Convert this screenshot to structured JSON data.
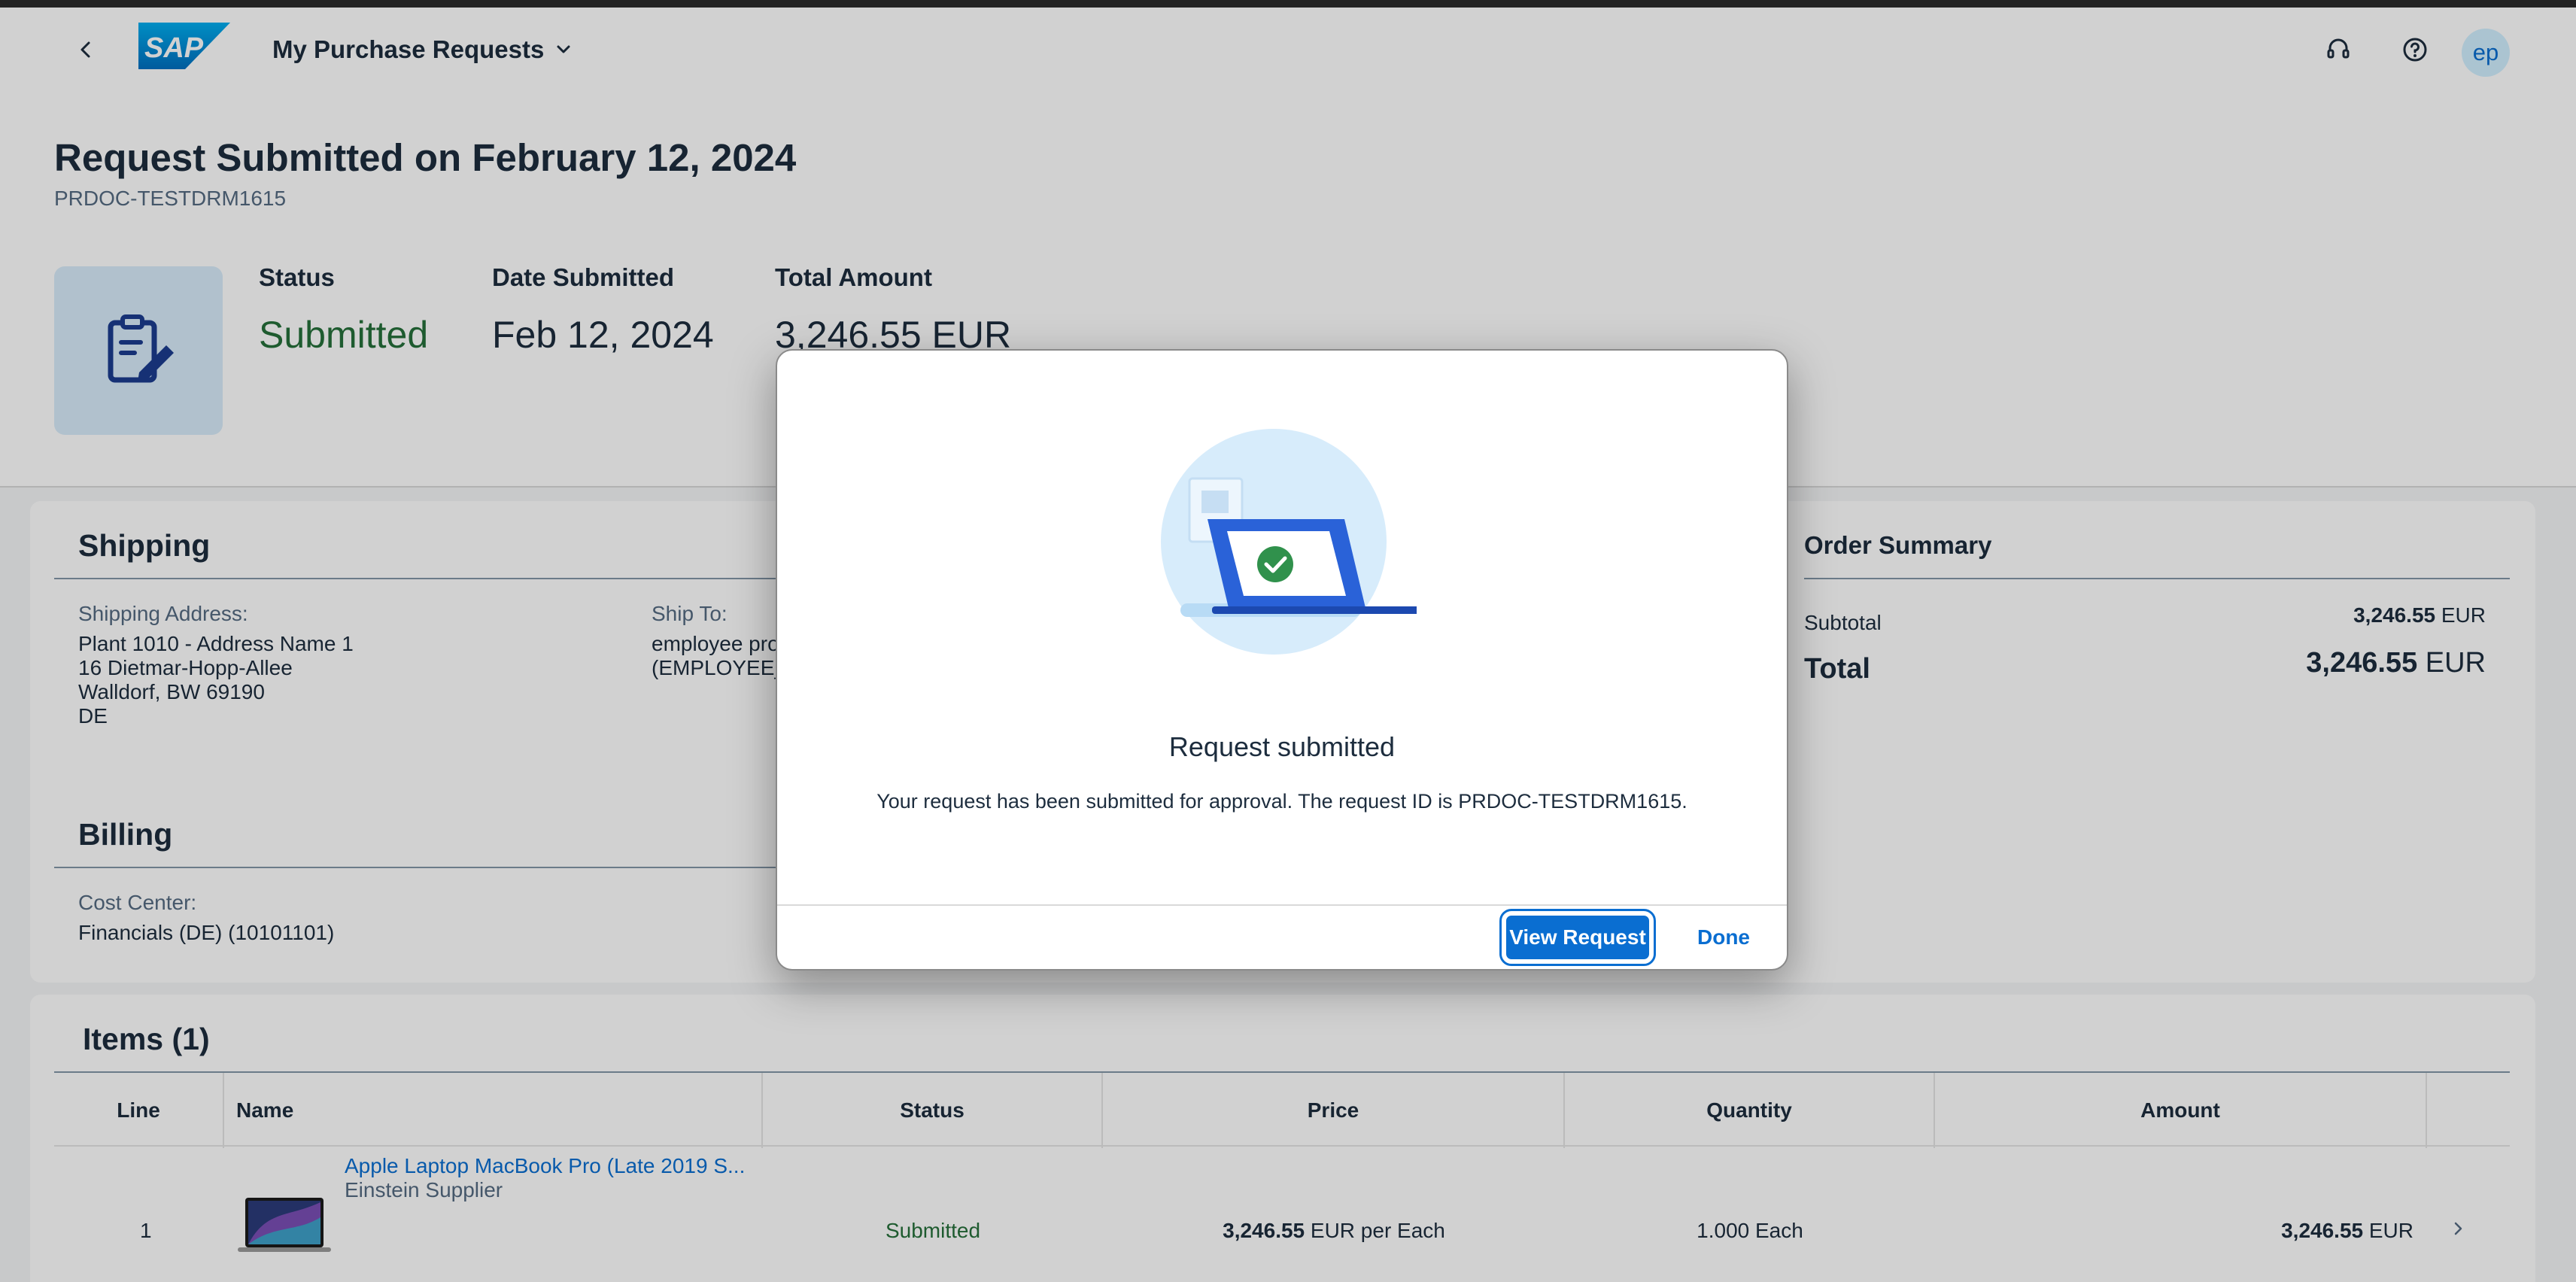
{
  "shell": {
    "app_title": "My Purchase Requests",
    "logo_text": "SAP",
    "avatar_initials": "ep",
    "icons": [
      "back-icon",
      "chevron-down-icon",
      "headset-icon",
      "help-icon"
    ]
  },
  "header": {
    "title": "Request Submitted on February 12, 2024",
    "document_id": "PRDOC-TESTDRM1615",
    "kpis": {
      "status_label": "Status",
      "status_value": "Submitted",
      "date_label": "Date Submitted",
      "date_value": "Feb 12, 2024",
      "amount_label": "Total Amount",
      "amount_value": "3,246.55",
      "amount_currency": "EUR"
    }
  },
  "shipping": {
    "title": "Shipping",
    "address_label": "Shipping Address:",
    "address_lines": [
      "Plant 1010 - Address Name 1",
      "16 Dietmar-Hopp-Allee",
      "Walldorf, BW 69190",
      "DE"
    ],
    "ship_to_label": "Ship To:",
    "ship_to_lines": [
      "employee pro",
      "(EMPLOYEE_"
    ]
  },
  "billing": {
    "title": "Billing",
    "cost_center_label": "Cost Center:",
    "cost_center_value": "Financials (DE) (10101101)"
  },
  "order_summary": {
    "title": "Order Summary",
    "subtotal_label": "Subtotal",
    "subtotal_value": "3,246.55",
    "subtotal_currency": "EUR",
    "total_label": "Total",
    "total_value": "3,246.55",
    "total_currency": "EUR"
  },
  "items": {
    "title": "Items (1)",
    "columns": [
      "Line",
      "Name",
      "Status",
      "Price",
      "Quantity",
      "Amount"
    ],
    "rows": [
      {
        "line": "1",
        "name": "Apple Laptop MacBook Pro (Late 2019 S...",
        "supplier": "Einstein Supplier",
        "status": "Submitted",
        "price_value": "3,246.55",
        "price_unit": "EUR per Each",
        "quantity": "1.000 Each",
        "amount_value": "3,246.55",
        "amount_currency": "EUR"
      }
    ]
  },
  "dialog": {
    "title": "Request submitted",
    "description": "Your request has been submitted for approval. The request ID is PRDOC-TESTDRM1615.",
    "primary_button": "View Request",
    "secondary_button": "Done"
  },
  "colors": {
    "accent": "#0a6ed1",
    "positive": "#256f3a",
    "text": "#1d2d3e",
    "muted": "#556b82"
  }
}
